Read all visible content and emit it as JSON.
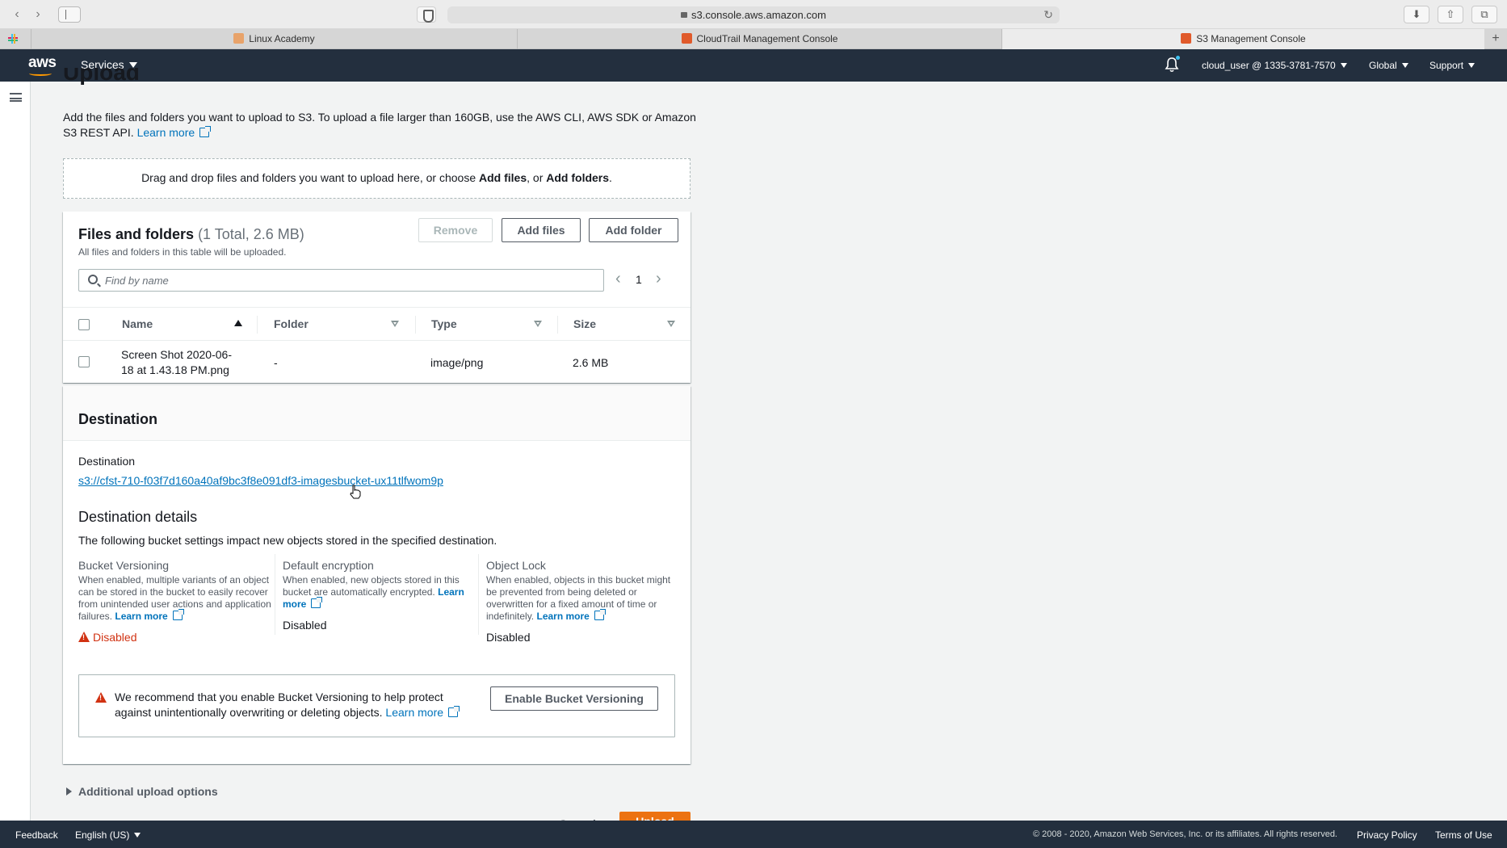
{
  "browser": {
    "address": "s3.console.aws.amazon.com",
    "tabs": [
      {
        "label": "Linux Academy",
        "favicon_color": "#e8a36a"
      },
      {
        "label": "CloudTrail Management Console",
        "favicon_color": "#e05a2b"
      },
      {
        "label": "S3 Management Console",
        "favicon_color": "#e05a2b"
      }
    ]
  },
  "aws_header": {
    "logo": "aws",
    "services": "Services",
    "user": "cloud_user @ 1335-3781-7570",
    "region": "Global",
    "support": "Support"
  },
  "page": {
    "title": "Upload",
    "intro": "Add the files and folders you want to upload to S3. To upload a file larger than 160GB, use the AWS CLI, AWS SDK or Amazon S3 REST API.",
    "learn_more": "Learn more",
    "dropzone": {
      "prefix": "Drag and drop files and folders you want to upload here, or choose ",
      "add_files": "Add files",
      "middle": ", or ",
      "add_folders": "Add folders",
      "suffix": "."
    }
  },
  "files_panel": {
    "title": "Files and folders",
    "counter": "(1 Total, 2.6 MB)",
    "description": "All files and folders in this table will be uploaded.",
    "buttons": {
      "remove": "Remove",
      "add_files": "Add files",
      "add_folder": "Add folder"
    },
    "search_placeholder": "Find by name",
    "page": "1",
    "columns": [
      "Name",
      "Folder",
      "Type",
      "Size"
    ],
    "rows": [
      {
        "name_line1": "Screen Shot 2020-06-",
        "name_line2": "18 at 1.43.18 PM.png",
        "folder": "-",
        "type": "image/png",
        "size": "2.6 MB"
      }
    ]
  },
  "destination": {
    "header": "Destination",
    "label": "Destination",
    "uri": "s3://cfst-710-f03f7d160a40af9bc3f8e091df3-imagesbucket-ux11tlfwom9p",
    "details_title": "Destination details",
    "details_desc": "The following bucket settings impact new objects stored in the specified destination.",
    "settings": [
      {
        "title": "Bucket Versioning",
        "desc": "When enabled, multiple variants of an object can be stored in the bucket to easily recover from unintended user actions and application failures.",
        "link": "Learn more",
        "value": "Disabled"
      },
      {
        "title": "Default encryption",
        "desc": "When enabled, new objects stored in this bucket are automatically encrypted.",
        "link": "Learn more",
        "value": "Disabled"
      },
      {
        "title": "Object Lock",
        "desc": "When enabled, objects in this bucket might be prevented from being deleted or overwritten for a fixed amount of time or indefinitely.",
        "link": "Learn more",
        "value": "Disabled"
      }
    ],
    "alert": {
      "text": "We recommend that you enable Bucket Versioning to help protect against unintentionally overwriting or deleting objects.",
      "link": "Learn more",
      "button": "Enable Bucket Versioning"
    }
  },
  "additional_options": "Additional upload options",
  "actions": {
    "cancel": "Cancel",
    "upload": "Upload"
  },
  "footer": {
    "feedback": "Feedback",
    "language": "English (US)",
    "copyright": "© 2008 - 2020, Amazon Web Services, Inc. or its affiliates. All rights reserved.",
    "privacy": "Privacy Policy",
    "terms": "Terms of Use"
  },
  "colors": {
    "aws_nav": "#232f3e",
    "link": "#0073bb",
    "upload_orange": "#ec7211",
    "warning_red": "#d13212"
  }
}
